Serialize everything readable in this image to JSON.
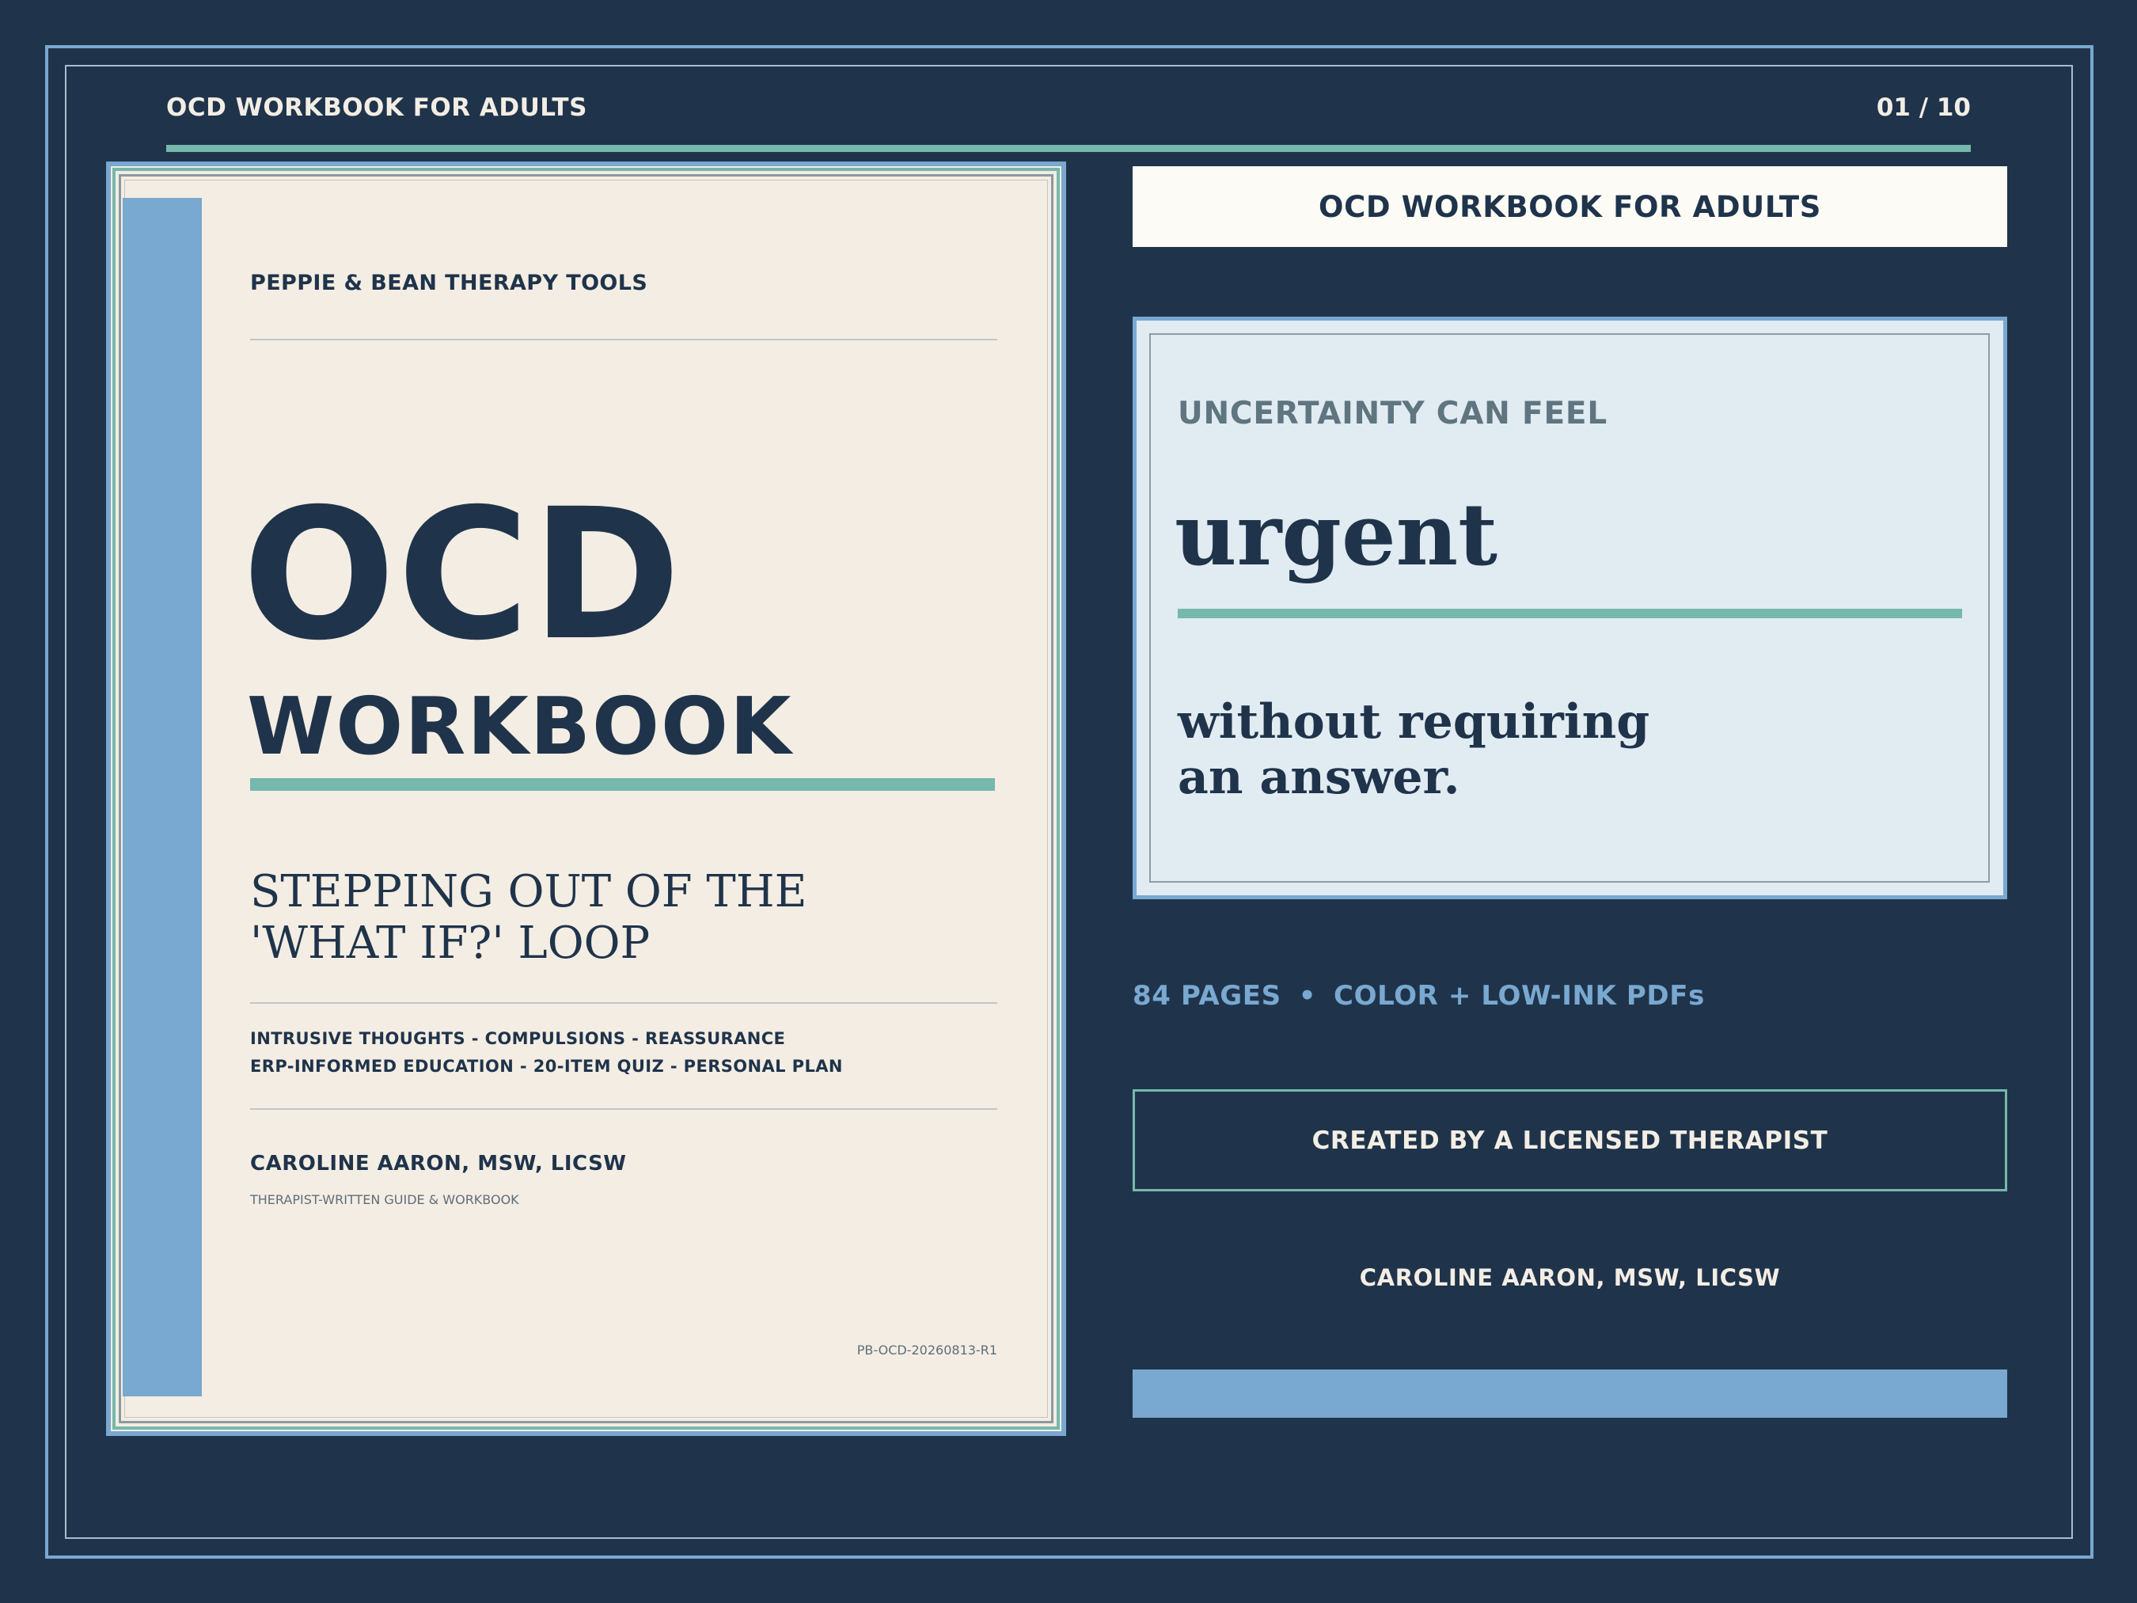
{
  "header": {
    "title": "OCD WORKBOOK FOR ADULTS",
    "page_indicator": "01 / 10"
  },
  "cover": {
    "publisher": "PEPPIE & BEAN THERAPY TOOLS",
    "title_main": "OCD",
    "title_secondary": "WORKBOOK",
    "subtitle_lines": [
      "STEPPING OUT OF THE",
      "'WHAT IF?' LOOP"
    ],
    "topics_lines": [
      "INTRUSIVE THOUGHTS  -  COMPULSIONS  -  REASSURANCE",
      "ERP-INFORMED EDUCATION  -  20-ITEM QUIZ  -  PERSONAL PLAN"
    ],
    "author": "CAROLINE AARON, MSW, LICSW",
    "author_note": "THERAPIST-WRITTEN GUIDE & WORKBOOK",
    "sku": "PB-OCD-20260813-R1"
  },
  "title_bar": {
    "label": "OCD WORKBOOK FOR ADULTS"
  },
  "quote": {
    "kicker": "UNCERTAINTY CAN FEEL",
    "emphasis": "urgent",
    "rest_lines": [
      "without requiring",
      "an answer."
    ]
  },
  "specs": {
    "pages": "84 PAGES",
    "separator": "•",
    "formats": "COLOR + LOW-INK PDFs"
  },
  "badge": {
    "label": "CREATED BY A LICENSED THERAPIST"
  },
  "author_line": "CAROLINE AARON, MSW, LICSW",
  "colors": {
    "background": "#1f344b",
    "accent_blue": "#79a8d0",
    "accent_teal": "#76b8ab",
    "cream": "#f4ede3",
    "ink": "#1f344b"
  }
}
